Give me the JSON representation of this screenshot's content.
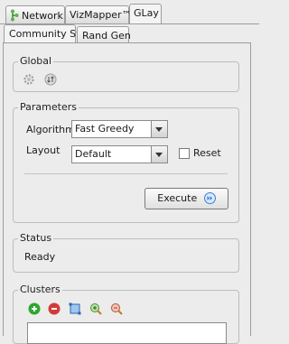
{
  "top_tabs": [
    {
      "label": "Network",
      "icon": "network-tree-icon"
    },
    {
      "label": "VizMapper™"
    },
    {
      "label": "GLay"
    }
  ],
  "sub_tabs": [
    {
      "label": "Community Str"
    },
    {
      "label": "Rand Gen"
    }
  ],
  "global": {
    "title": "Global",
    "icons": [
      "gear-icon",
      "refresh-icon"
    ]
  },
  "parameters": {
    "title": "Parameters",
    "algorithm_label": "Algorithm",
    "algorithm_value": "Fast Greedy",
    "layout_label": "Layout",
    "layout_value": "Default",
    "reset_label": "Reset",
    "reset_checked": false,
    "execute_label": "Execute"
  },
  "status": {
    "title": "Status",
    "value": "Ready"
  },
  "clusters": {
    "title": "Clusters",
    "icons": [
      "add-icon",
      "remove-icon",
      "select-icon",
      "zoom-in-icon",
      "zoom-out-icon"
    ]
  },
  "colors": {
    "add": "#2fa52f",
    "remove": "#d23a3a",
    "execute": "#3a7fd8"
  }
}
